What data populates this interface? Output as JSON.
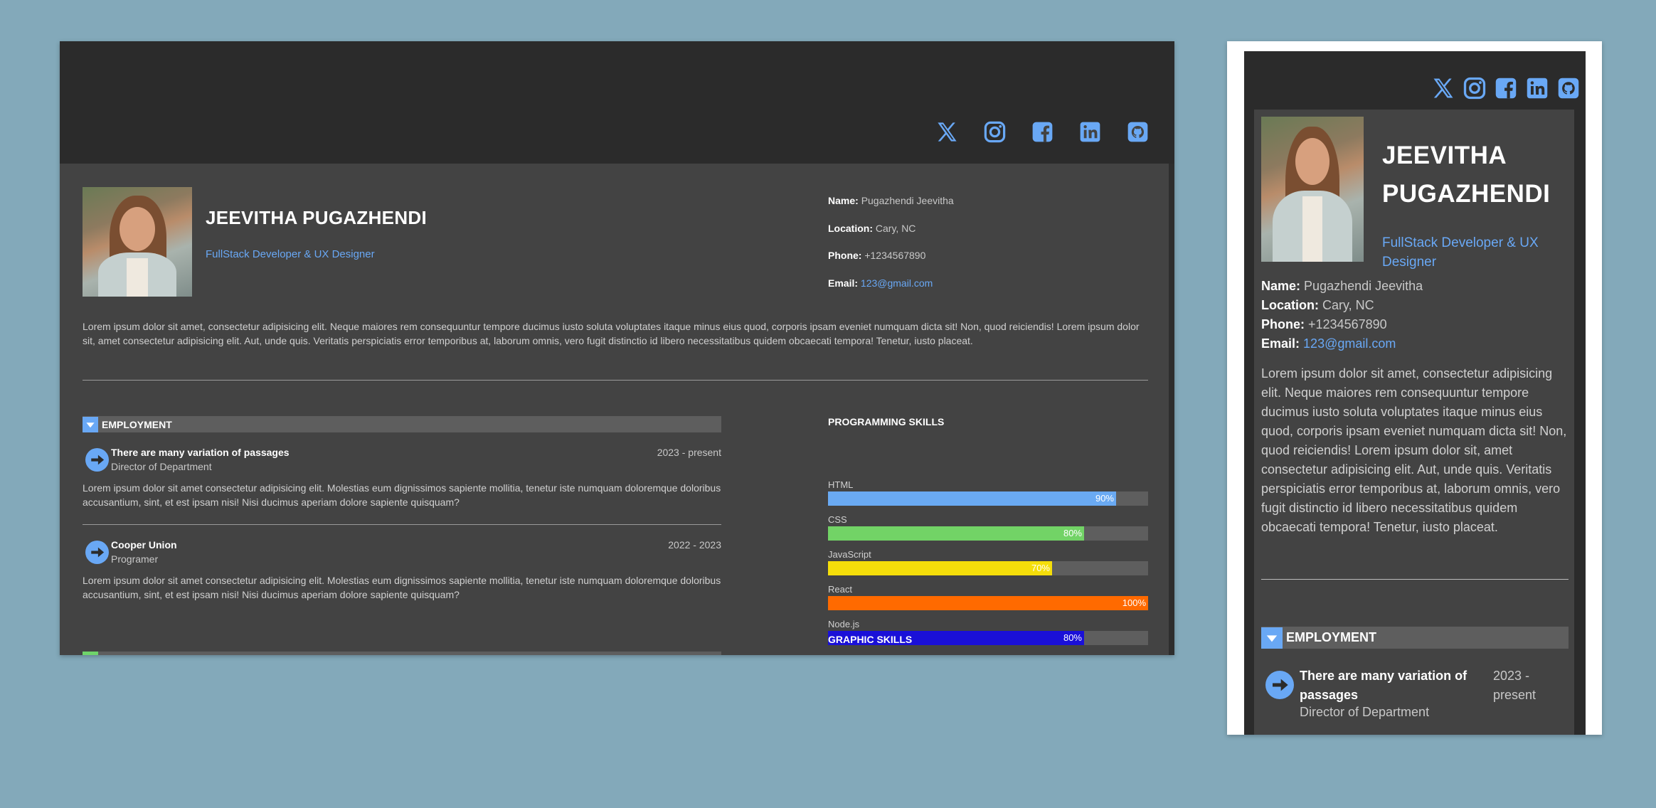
{
  "profile": {
    "name": "JEEVITHA PUGAZHENDI",
    "name_mobile_line1": "JEEVITHA",
    "name_mobile_line2": "PUGAZHENDI",
    "role": "FullStack Developer & UX Designer",
    "info": [
      {
        "label": "Name:",
        "value": "Pugazhendi Jeevitha"
      },
      {
        "label": "Location:",
        "value": "Cary, NC"
      },
      {
        "label": "Phone:",
        "value": "+1234567890"
      },
      {
        "label": "Email:",
        "value": "123@gmail.com"
      }
    ],
    "about": "Lorem ipsum dolor sit amet, consectetur adipisicing elit. Neque maiores rem consequuntur tempore ducimus iusto soluta voluptates itaque minus eius quod, corporis ipsam eveniet numquam dicta sit! Non, quod reiciendis! Lorem ipsum dolor sit, amet consectetur adipisicing elit. Aut, unde quis. Veritatis perspiciatis error temporibus at, laborum omnis, vero fugit distinctio id libero necessitatibus quidem obcaecati tempora! Tenetur, iusto placeat."
  },
  "social": [
    {
      "icon": "x-twitter-icon"
    },
    {
      "icon": "instagram-icon"
    },
    {
      "icon": "facebook-icon"
    },
    {
      "icon": "linkedin-icon"
    },
    {
      "icon": "github-icon"
    }
  ],
  "employment": {
    "title": "EMPLOYMENT",
    "jobs": [
      {
        "title": "There are many variation of passages",
        "position": "Director of Department",
        "date": "2023 - present",
        "date_mobile_line1": "2023 -",
        "date_mobile_line2": "present",
        "description": "Lorem ipsum dolor sit amet consectetur adipisicing elit. Molestias eum dignissimos sapiente mollitia, tenetur iste numquam doloremque doloribus accusantium, sint, et est ipsam nisi! Nisi ducimus aperiam dolore sapiente quisquam?"
      },
      {
        "title": "Cooper Union",
        "position": "Programer",
        "date": "2022 - 2023",
        "description": "Lorem ipsum dolor sit amet consectetur adipisicing elit. Molestias eum dignissimos sapiente mollitia, tenetur iste numquam doloremque doloribus accusantium, sint, et est ipsam nisi! Nisi ducimus aperiam dolore sapiente quisquam?"
      }
    ]
  },
  "programming_skills": {
    "title": "PROGRAMMING SKILLS",
    "items": [
      {
        "name": "HTML",
        "percent": 90,
        "label": "90%",
        "color": "#6aaaf3"
      },
      {
        "name": "CSS",
        "percent": 80,
        "label": "80%",
        "color": "#72d366"
      },
      {
        "name": "JavaScript",
        "percent": 70,
        "label": "70%",
        "color": "#f5de0a"
      },
      {
        "name": "React",
        "percent": 100,
        "label": "100%",
        "color": "#ff6a00"
      },
      {
        "name": "Node.js",
        "percent": 80,
        "label": "80%",
        "color": "#1a10d8"
      }
    ]
  },
  "graphic_skills": {
    "title": "GRAPHIC SKILLS"
  },
  "colors": {
    "accent": "#69a8f5",
    "header_bg": "#2b2b2b",
    "panel_bg": "#434343",
    "page_bg": "#83a9ba"
  }
}
